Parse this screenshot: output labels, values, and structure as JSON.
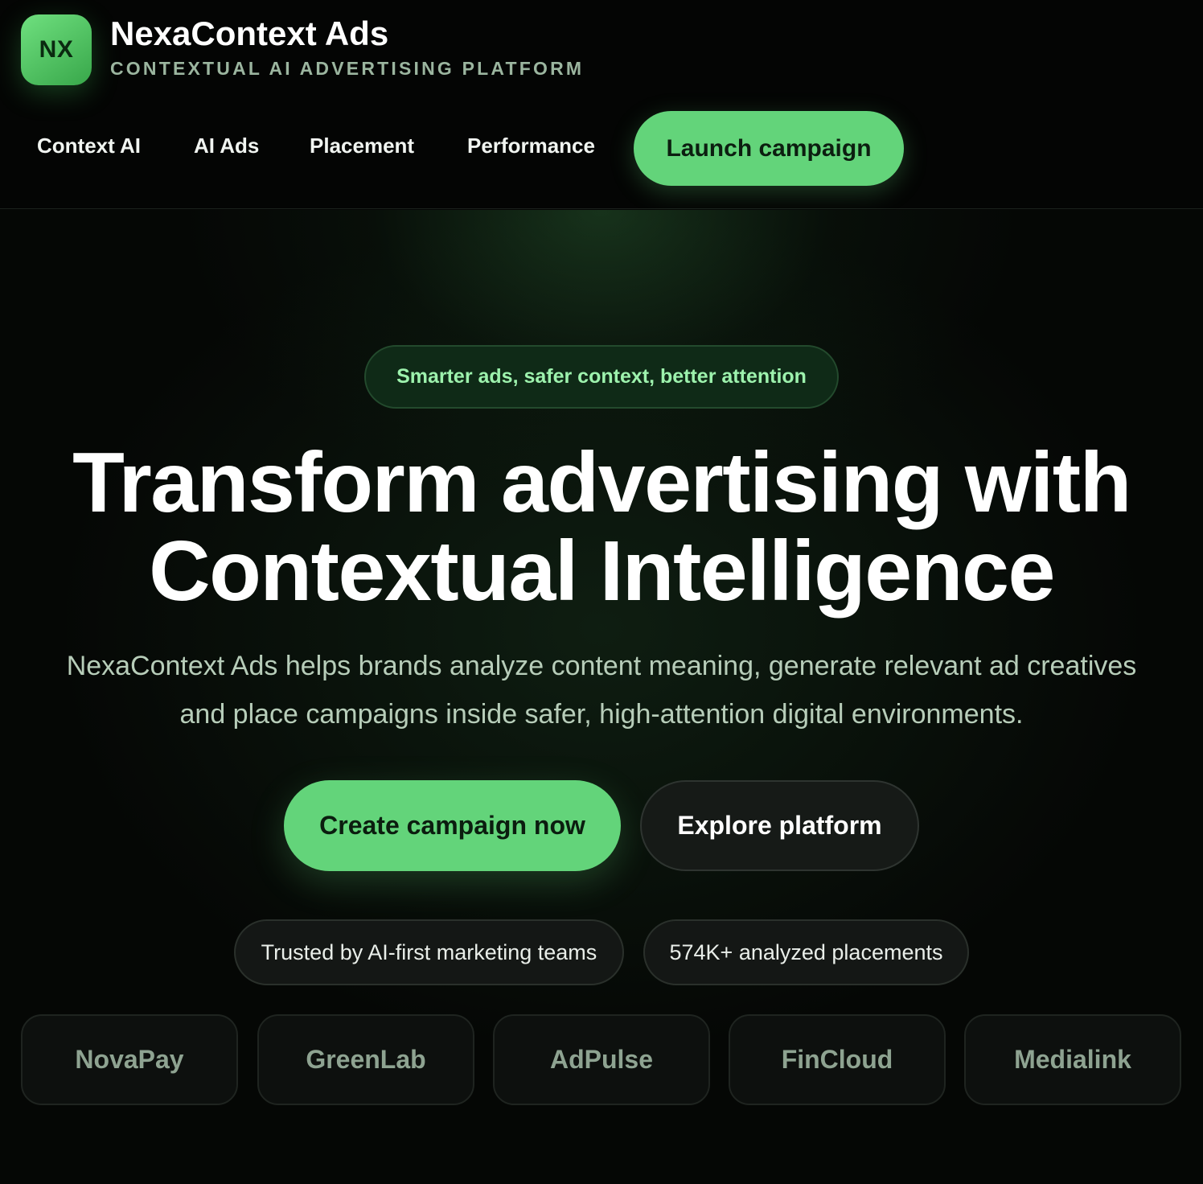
{
  "brand": {
    "logo_initials": "NX",
    "name": "NexaContext Ads",
    "tagline": "CONTEXTUAL AI ADVERTISING PLATFORM"
  },
  "nav": {
    "items": [
      {
        "label": "Context AI"
      },
      {
        "label": "AI Ads"
      },
      {
        "label": "Placement"
      },
      {
        "label": "Performance"
      }
    ],
    "cta_label": "Launch campaign"
  },
  "hero": {
    "badge": "Smarter ads, safer context, better attention",
    "title_line1": "Transform advertising with",
    "title_line2": "Contextual Intelligence",
    "description_line1": "NexaContext Ads helps brands analyze content meaning, generate relevant ad creatives",
    "description_line2": "and place campaigns inside safer, high-attention digital environments.",
    "primary_button": "Create campaign now",
    "secondary_button": "Explore platform"
  },
  "trust": {
    "pills": [
      {
        "label": "Trusted by AI-first marketing teams"
      },
      {
        "label": "574K+ analyzed placements"
      }
    ]
  },
  "clients": {
    "logos": [
      {
        "name": "NovaPay"
      },
      {
        "name": "GreenLab"
      },
      {
        "name": "AdPulse"
      },
      {
        "name": "FinCloud"
      },
      {
        "name": "Medialink"
      }
    ]
  },
  "colors": {
    "accent": "#63d47a",
    "background": "#040504",
    "badge_text": "#9df2ad",
    "muted_text": "#b7cdb9"
  }
}
